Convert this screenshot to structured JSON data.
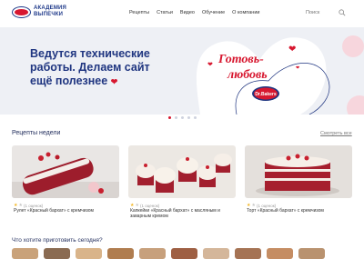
{
  "brand": {
    "logo_text": "Dr.Bakers",
    "site_name_line1": "АКАДЕМИЯ",
    "site_name_line2": "ВЫПЕЧКИ"
  },
  "nav": {
    "items": [
      "Рецепты",
      "Статьи",
      "Видео",
      "Обучение",
      "О компании"
    ]
  },
  "search": {
    "placeholder": "Поиск"
  },
  "hero": {
    "line1": "Ведутся технические",
    "line2": "работы. Делаем сайт",
    "line3": "ещё полезнее",
    "slogan_line1": "Готовь-",
    "slogan_line2": "любовь",
    "badge": "Dr.Bakers",
    "slides_count": 5,
    "active_slide": 1
  },
  "recipes_week": {
    "title": "Рецепты недели",
    "see_all": "Смотреть все",
    "cards": [
      {
        "title": "Рулет «Красный бархат» с кремчизом",
        "rating_text": "(1 оценок)",
        "stars": 1
      },
      {
        "title": "Капкейки «Красный бархат» с масляным и заварным кремом",
        "rating_text": "(1 оценок)",
        "stars": 1
      },
      {
        "title": "Торт «Красный бархат» с кремчизом",
        "rating_text": "(1 оценок)",
        "stars": 1
      }
    ]
  },
  "what_to_cook": {
    "title": "Что хотите приготовить сегодня?"
  },
  "colors": {
    "brand_blue": "#1f3580",
    "brand_red": "#d7172f",
    "hero_bg": "#eef0f5"
  }
}
